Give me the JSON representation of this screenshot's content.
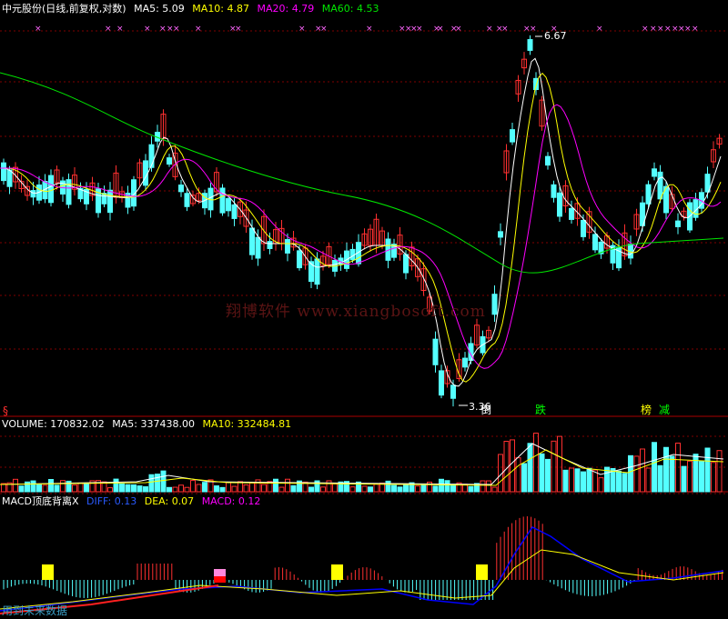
{
  "panels": {
    "price_header": {
      "stock": "中元股份(日线,前复权,对数)",
      "ma5": "MA5: 5.09",
      "ma10": "MA10: 4.87",
      "ma20": "MA20: 4.79",
      "ma60": "MA60: 4.53"
    },
    "volume_header": {
      "volume": "VOLUME: 170832.02",
      "ma5": "MA5: 337438.00",
      "ma10": "MA10: 332484.81"
    },
    "macd_header": {
      "name": "MACD顶底背离X",
      "diff": "DIFF: 0.13",
      "dea": "DEA: 0.07",
      "macd": "MACD: 0.12"
    }
  },
  "annotations": {
    "high": "6.67",
    "low": "3.36",
    "signal_buy": "倒",
    "signal_drop": "跌",
    "signal_bang": "榜",
    "signal_reduce": "减",
    "s_mark": "§"
  },
  "watermark": "翔博软件 www.xiangbosoft.com",
  "footer": "用到未来数据",
  "colors": {
    "up": "#ff3030",
    "down": "#54ffff",
    "ma5": "#ffffff",
    "ma10": "#ffff00",
    "ma20": "#ff00ff",
    "ma60": "#00e600",
    "grid": "#800000",
    "diff": "#0000ff",
    "dea": "#ffff00",
    "signal": "#ffff00",
    "mark": "#ff66ff"
  },
  "chart_data": [
    {
      "type": "candlestick",
      "title": "中元股份(日线,前复权,对数)",
      "scale": "log",
      "price_range": [
        3.36,
        6.67
      ],
      "series": [
        {
          "name": "MA5",
          "value": 5.09
        },
        {
          "name": "MA10",
          "value": 4.87
        },
        {
          "name": "MA20",
          "value": 4.79
        },
        {
          "name": "MA60",
          "value": 4.53
        }
      ],
      "annotations": [
        {
          "label": "6.67",
          "kind": "high"
        },
        {
          "label": "3.36",
          "kind": "low"
        }
      ],
      "grid": true
    },
    {
      "type": "bar",
      "title": "VOLUME",
      "series": [
        {
          "name": "VOLUME",
          "value": 170832.02
        },
        {
          "name": "MA5",
          "value": 337438.0
        },
        {
          "name": "MA10",
          "value": 332484.81
        }
      ]
    },
    {
      "type": "bar",
      "title": "MACD顶底背离X",
      "series": [
        {
          "name": "DIFF",
          "value": 0.13
        },
        {
          "name": "DEA",
          "value": 0.07
        },
        {
          "name": "MACD",
          "value": 0.12
        }
      ]
    }
  ]
}
